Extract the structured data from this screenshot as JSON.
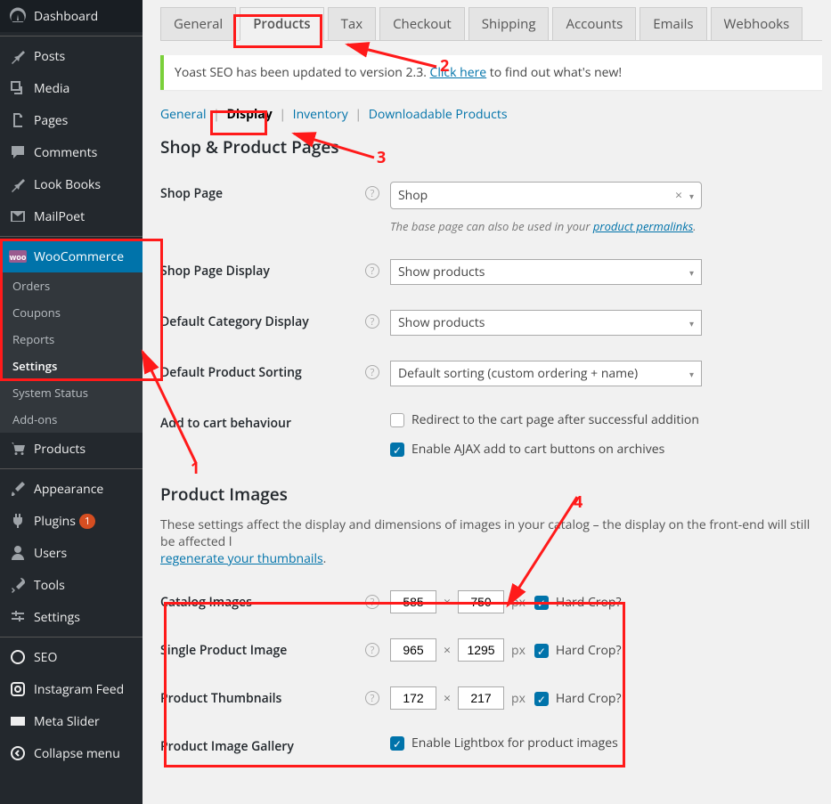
{
  "sidebar": {
    "dashboard": "Dashboard",
    "posts": "Posts",
    "media": "Media",
    "pages": "Pages",
    "comments": "Comments",
    "lookbooks": "Look Books",
    "mailpoet": "MailPoet",
    "woocommerce": "WooCommerce",
    "sub": {
      "orders": "Orders",
      "coupons": "Coupons",
      "reports": "Reports",
      "settings": "Settings",
      "system": "System Status",
      "addons": "Add-ons"
    },
    "products": "Products",
    "appearance": "Appearance",
    "plugins": "Plugins",
    "plugins_badge": "1",
    "users": "Users",
    "tools": "Tools",
    "settings": "Settings",
    "seo": "SEO",
    "instagram": "Instagram Feed",
    "metaslider": "Meta Slider",
    "collapse": "Collapse menu"
  },
  "tabs": {
    "general": "General",
    "products": "Products",
    "tax": "Tax",
    "checkout": "Checkout",
    "shipping": "Shipping",
    "accounts": "Accounts",
    "emails": "Emails",
    "webhooks": "Webhooks"
  },
  "notice": {
    "t1": "Yoast SEO has been updated to version 2.3. ",
    "link": "Click here",
    "t2": " to find out what's new!"
  },
  "subsub": {
    "general": "General",
    "display": "Display",
    "inventory": "Inventory",
    "download": "Downloadable Products"
  },
  "h1": "Shop & Product Pages",
  "h2": "Product Images",
  "row": {
    "shop_page": "Shop Page",
    "shop_page_val": "Shop",
    "shop_page_hint1": "The base page can also be used in your ",
    "shop_page_link": "product permalinks",
    "shop_page_hint2": ".",
    "shop_display": "Shop Page Display",
    "shop_display_val": "Show products",
    "cat_display": "Default Category Display",
    "cat_display_val": "Show products",
    "sort": "Default Product Sorting",
    "sort_val": "Default sorting (custom ordering + name)",
    "add_cart": "Add to cart behaviour",
    "add_cart_opt1": "Redirect to the cart page after successful addition",
    "add_cart_opt2": "Enable AJAX add to cart buttons on archives",
    "images_desc1": "These settings affect the display and dimensions of images in your catalog – the display on the front-end will still be affected l",
    "images_link": "regenerate your thumbnails",
    "images_desc2": ".",
    "catalog": "Catalog Images",
    "catalog_w": "585",
    "catalog_h": "750",
    "single": "Single Product Image",
    "single_w": "965",
    "single_h": "1295",
    "thumbs": "Product Thumbnails",
    "thumbs_w": "172",
    "thumbs_h": "217",
    "hard_crop": "Hard Crop?",
    "px": "px",
    "gallery": "Product Image Gallery",
    "gallery_opt": "Enable Lightbox for product images"
  },
  "anno": {
    "1": "1",
    "2": "2",
    "3": "3",
    "4": "4"
  }
}
